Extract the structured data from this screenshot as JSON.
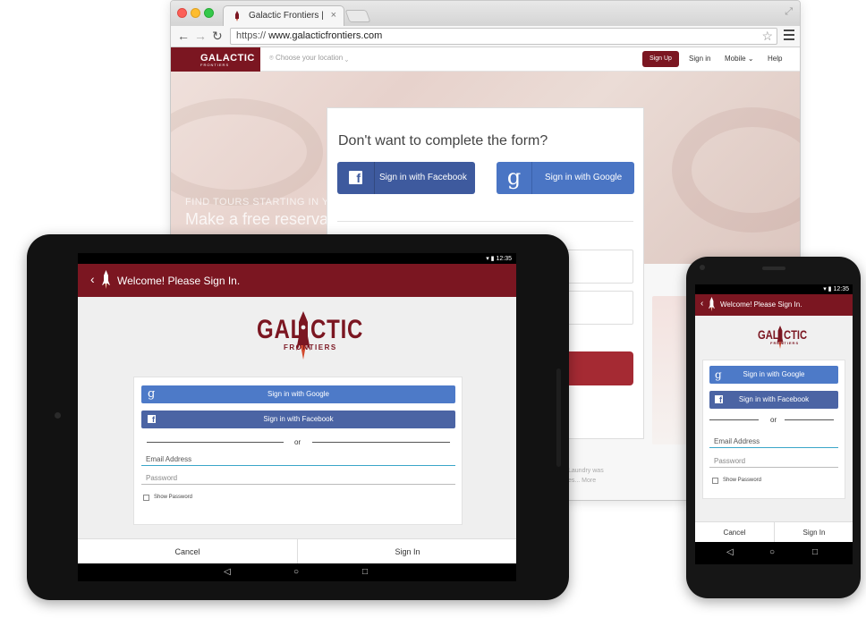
{
  "browser": {
    "tab_title": "Galactic Frontiers |",
    "tab_close": "×",
    "url_scheme": "https://",
    "url_host": "www.galacticfrontiers.com"
  },
  "site": {
    "logo_text": "GALACTIC",
    "logo_sub": "FRONTIERS",
    "location_placeholder": "Choose your location",
    "nav": {
      "signup": "Sign Up",
      "signin": "Sign in",
      "mobile": "Mobile",
      "help": "Help"
    },
    "hero_tagline": "FIND TOURS STARTING IN YOUR",
    "hero_headline": "Make a free reservat",
    "side_text_1": "Laundry was",
    "side_text_2": "es... More",
    "form": {
      "title": "Don't want to complete the form?",
      "facebook_button": "Sign in with Facebook",
      "google_button": "Sign in with Google"
    }
  },
  "tablet": {
    "time": "12:35",
    "title": "Welcome! Please Sign In.",
    "logo_left": "GAL",
    "logo_right": "CTIC",
    "logo_sub": "FRONTIERS",
    "google_button": "Sign in with Google",
    "facebook_button": "Sign in with Facebook",
    "or": "or",
    "email_placeholder": "Email Address",
    "password_placeholder": "Password",
    "show_password": "Show Password",
    "cancel": "Cancel",
    "sign_in": "Sign In"
  },
  "phone": {
    "time": "12:35",
    "title": "Welcome! Please Sign In.",
    "logo_left": "GAL",
    "logo_right": "CTIC",
    "logo_sub": "FRONTIERS",
    "google_button": "Sign in with Google",
    "facebook_button": "Sign in with Facebook",
    "or": "or",
    "email_placeholder": "Email Address",
    "password_placeholder": "Password",
    "show_password": "Show Password",
    "cancel": "Cancel",
    "sign_in": "Sign In"
  },
  "colors": {
    "brand": "#7b1621",
    "facebook": "#3e5a9e",
    "google": "#4a75c4"
  }
}
